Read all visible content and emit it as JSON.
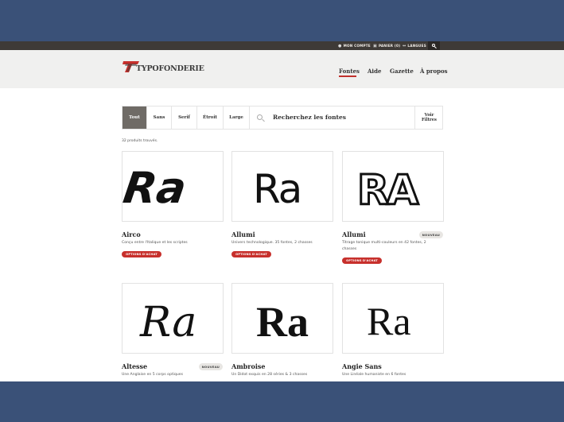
{
  "utility_bar": {
    "account": "MON COMPTE",
    "cart": "PANIER (0)",
    "languages": "LANGUES"
  },
  "header": {
    "logo_text": "TYPOFONDERIE",
    "nav": [
      {
        "label": "Fontes",
        "active": true
      },
      {
        "label": "Aide"
      },
      {
        "label": "Gazette"
      },
      {
        "label": "À propos"
      }
    ]
  },
  "filters": {
    "tabs": [
      "Tout",
      "Sans",
      "Serif",
      "Étroit",
      "Large"
    ],
    "selected": "Tout",
    "search_placeholder": "Recherchez les fontes",
    "filters_button_line1": "Voir",
    "filters_button_line2": "Filtres"
  },
  "results_count": "32 produits trouvés.",
  "products": [
    {
      "name": "Airco",
      "description": "Conçu entre l'Italique et les scriptes",
      "buy_label": "OPTIONS D'ACHAT",
      "sample": "Ra",
      "badge": ""
    },
    {
      "name": "Allumi",
      "description": "Univers technologique. 35 fontes, 2 chasses",
      "buy_label": "OPTIONS D'ACHAT",
      "sample": "Ra",
      "badge": ""
    },
    {
      "name": "Allumi",
      "description": "Titrage tonique multi-couleurs en 42 fontes, 2 chasses",
      "buy_label": "OPTIONS D'ACHAT",
      "sample": "RA",
      "badge": "NOUVEAU"
    },
    {
      "name": "Altesse",
      "description": "Une Anglaise en 5 corps optiques",
      "buy_label": "",
      "sample": "Ra",
      "badge": "NOUVEAU"
    },
    {
      "name": "Ambroise",
      "description": "Un Didot exquis en 28 séries & 3 chasses",
      "buy_label": "",
      "sample": "Ra",
      "badge": ""
    },
    {
      "name": "Angie Sans",
      "description": "Une Linéale humaniste en 6 fontes",
      "buy_label": "",
      "sample": "Ra",
      "badge": ""
    }
  ],
  "colors": {
    "page_background": "#3a5178",
    "utility_bar": "#3e3a37",
    "header": "#f0f0ef",
    "accent_red": "#c7302c",
    "active_tab": "#6f6b66"
  }
}
